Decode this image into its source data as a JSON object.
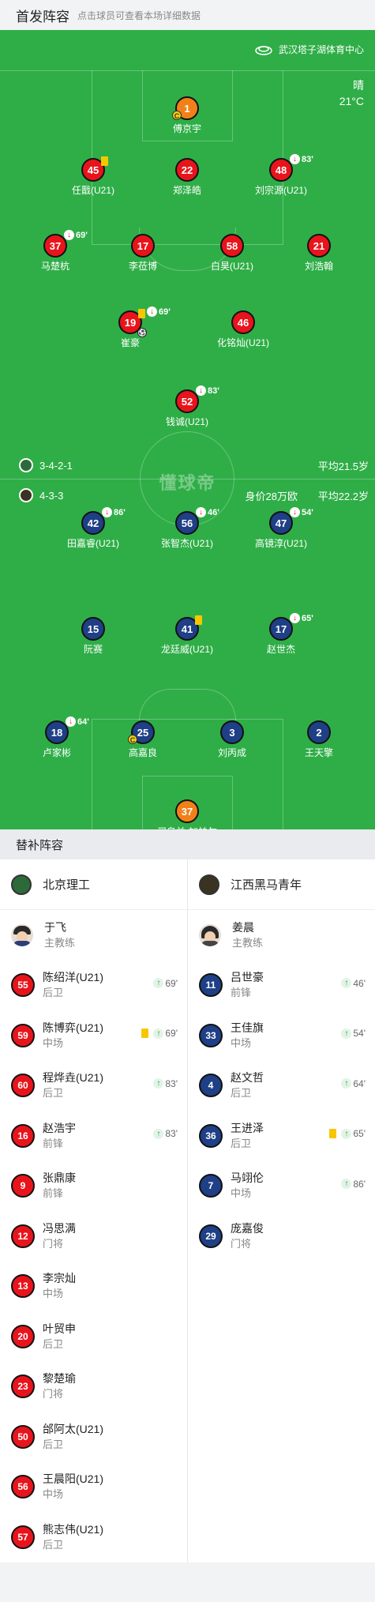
{
  "header": {
    "title": "首发阵容",
    "hint": "点击球员可查看本场详细数据"
  },
  "pitch": {
    "venue": "武汉塔子湖体育中心",
    "weather": "晴",
    "temperature": "21°C",
    "watermark": "懂球帝",
    "home": {
      "formation": "3-4-2-1",
      "avg_age": "平均21.5岁"
    },
    "away": {
      "formation": "4-3-3",
      "value": "身价28万欧",
      "avg_age": "平均22.2岁"
    },
    "home_players": [
      {
        "num": "1",
        "name": "傅京宇",
        "gk": true,
        "captain": true
      },
      {
        "num": "45",
        "name": "任戬(U21)",
        "yellow": true
      },
      {
        "num": "22",
        "name": "郑泽皓"
      },
      {
        "num": "48",
        "name": "刘宗源(U21)",
        "sub": "83'"
      },
      {
        "num": "37",
        "name": "马楚杭",
        "sub": "69'"
      },
      {
        "num": "17",
        "name": "李莅博"
      },
      {
        "num": "58",
        "name": "白昊(U21)"
      },
      {
        "num": "21",
        "name": "刘浩翰"
      },
      {
        "num": "19",
        "name": "崔豪",
        "yellow": true,
        "sub": "69'",
        "goal": true
      },
      {
        "num": "46",
        "name": "化铭灿(U21)"
      },
      {
        "num": "52",
        "name": "钱诚(U21)",
        "sub": "83'"
      }
    ],
    "away_players": [
      {
        "num": "42",
        "name": "田嘉睿(U21)",
        "sub": "86'"
      },
      {
        "num": "56",
        "name": "张智杰(U21)",
        "sub": "46'"
      },
      {
        "num": "47",
        "name": "高镜淳(U21)",
        "sub": "54'"
      },
      {
        "num": "15",
        "name": "阮赛"
      },
      {
        "num": "41",
        "name": "龙廷威(U21)",
        "yellow": true
      },
      {
        "num": "17",
        "name": "赵世杰",
        "sub": "65'"
      },
      {
        "num": "18",
        "name": "卢家彬",
        "sub": "64'"
      },
      {
        "num": "25",
        "name": "高嘉良",
        "captain": true
      },
      {
        "num": "3",
        "name": "刘丙成"
      },
      {
        "num": "2",
        "name": "王天擎"
      },
      {
        "num": "37",
        "name": "买乌兰·加帕尔",
        "gk": true
      }
    ]
  },
  "subs": {
    "title": "替补阵容",
    "home": {
      "team": "北京理工",
      "coach": {
        "name": "于飞",
        "role": "主教练"
      },
      "players": [
        {
          "num": "55",
          "name": "陈绍洋(U21)",
          "pos": "后卫",
          "in": "69'"
        },
        {
          "num": "59",
          "name": "陈博弈(U21)",
          "pos": "中场",
          "in": "69'",
          "yellow": true
        },
        {
          "num": "60",
          "name": "程烨垚(U21)",
          "pos": "后卫",
          "in": "83'"
        },
        {
          "num": "16",
          "name": "赵浩宇",
          "pos": "前锋",
          "in": "83'"
        },
        {
          "num": "9",
          "name": "张鼎康",
          "pos": "前锋"
        },
        {
          "num": "12",
          "name": "冯思满",
          "pos": "门将"
        },
        {
          "num": "13",
          "name": "李宗灿",
          "pos": "中场"
        },
        {
          "num": "20",
          "name": "叶贸申",
          "pos": "后卫"
        },
        {
          "num": "23",
          "name": "黎楚瑜",
          "pos": "门将"
        },
        {
          "num": "50",
          "name": "邰阿太(U21)",
          "pos": "后卫"
        },
        {
          "num": "56",
          "name": "王晨阳(U21)",
          "pos": "中场"
        },
        {
          "num": "57",
          "name": "熊志伟(U21)",
          "pos": "后卫"
        }
      ]
    },
    "away": {
      "team": "江西黑马青年",
      "coach": {
        "name": "姜晨",
        "role": "主教练"
      },
      "players": [
        {
          "num": "11",
          "name": "吕世豪",
          "pos": "前锋",
          "in": "46'"
        },
        {
          "num": "33",
          "name": "王佳旗",
          "pos": "中场",
          "in": "54'"
        },
        {
          "num": "4",
          "name": "赵文哲",
          "pos": "后卫",
          "in": "64'"
        },
        {
          "num": "36",
          "name": "王进泽",
          "pos": "后卫",
          "in": "65'",
          "yellow": true
        },
        {
          "num": "7",
          "name": "马翊伦",
          "pos": "中场",
          "in": "86'"
        },
        {
          "num": "29",
          "name": "庞嘉俊",
          "pos": "门将"
        }
      ]
    }
  },
  "colors": {
    "home": "#e8141c",
    "away": "#1f3f86",
    "gk": "#f28019",
    "pitch": "#2fae47"
  }
}
